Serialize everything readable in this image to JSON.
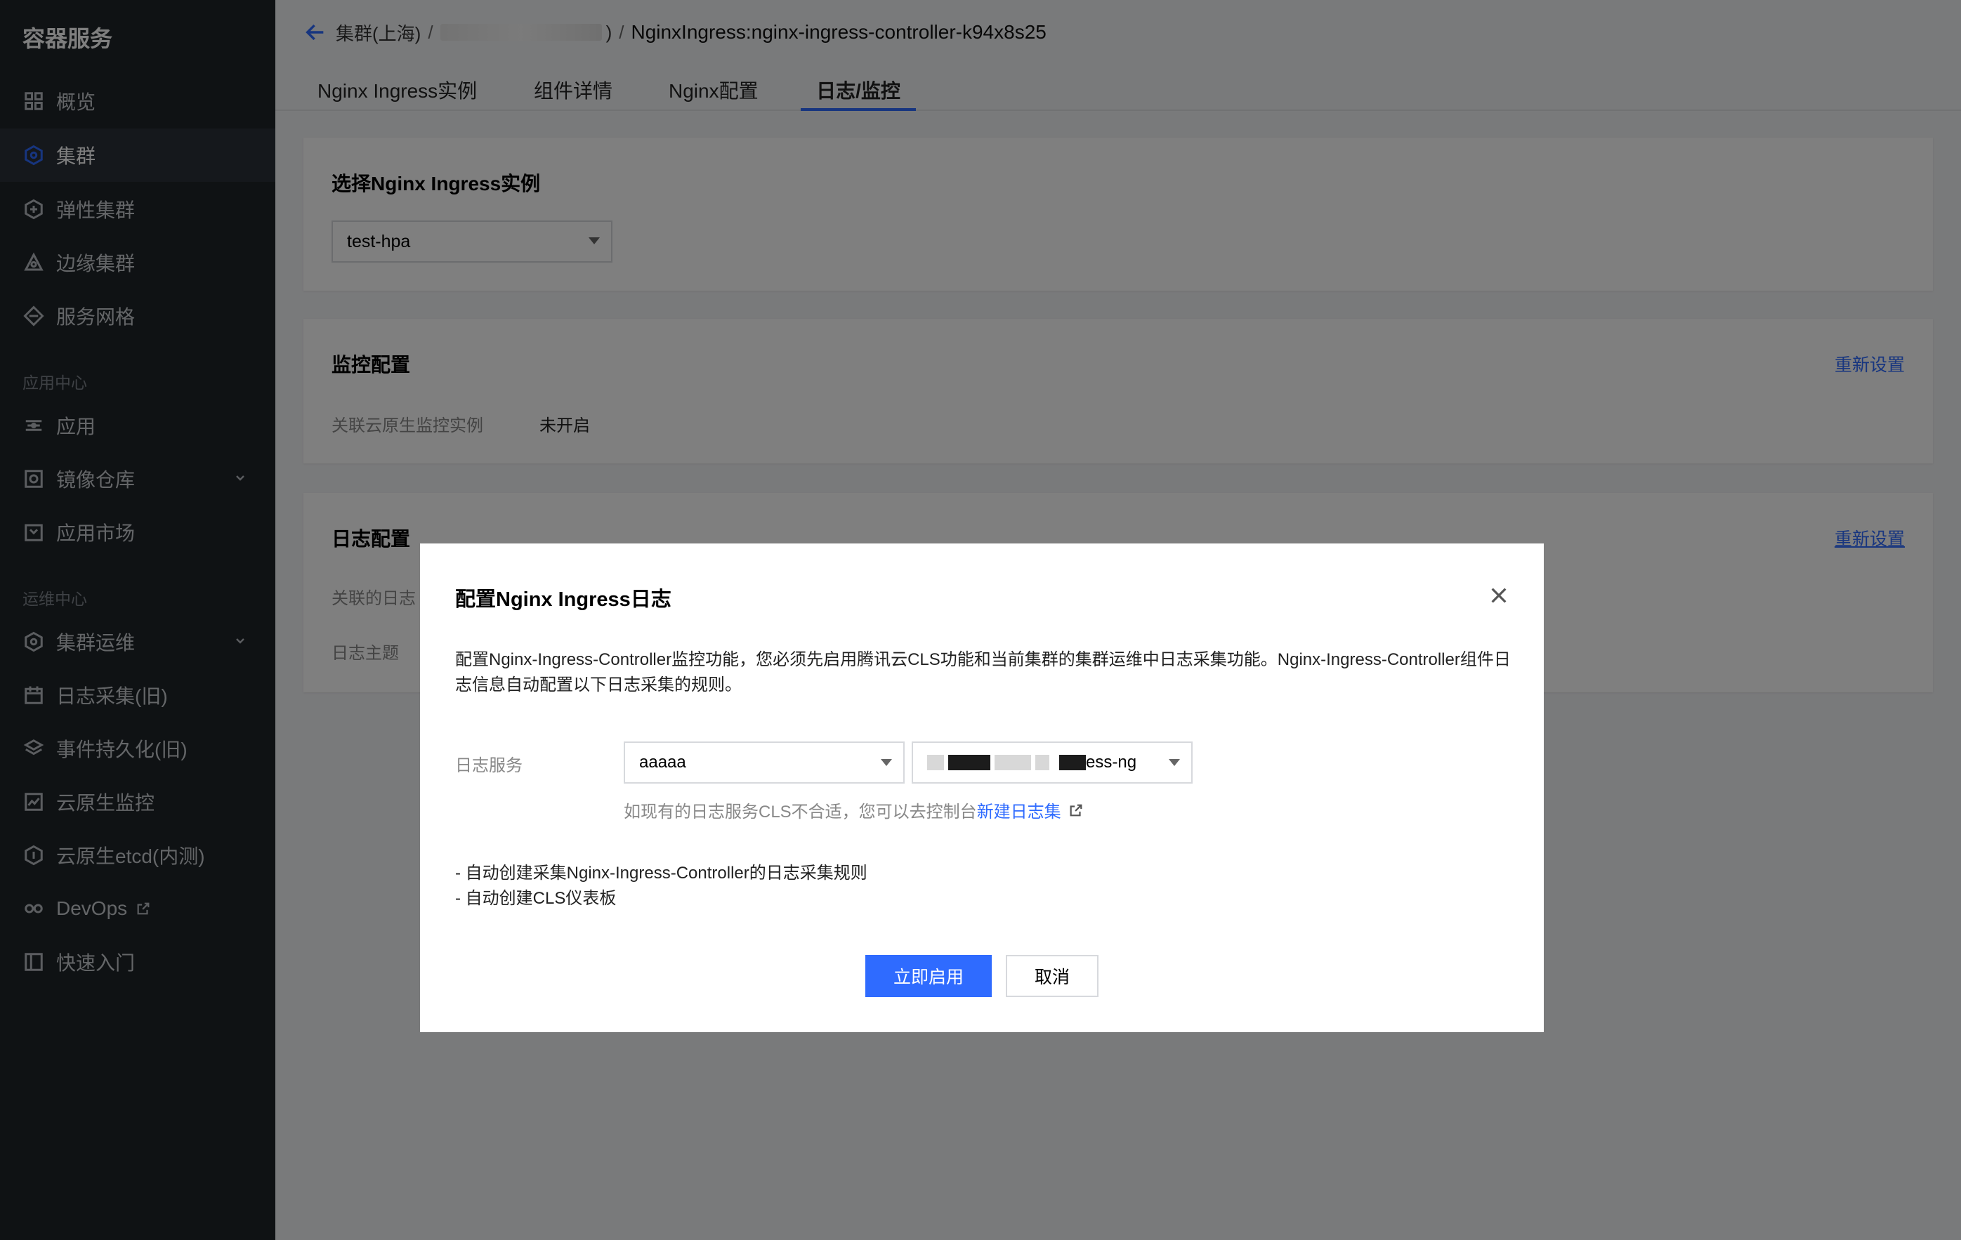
{
  "sidebar": {
    "brand": "容器服务",
    "items": [
      {
        "label": "概览",
        "icon": "dashboard-icon"
      },
      {
        "label": "集群",
        "icon": "cluster-icon",
        "active": true
      },
      {
        "label": "弹性集群",
        "icon": "elastic-cluster-icon"
      },
      {
        "label": "边缘集群",
        "icon": "edge-cluster-icon"
      },
      {
        "label": "服务网格",
        "icon": "service-mesh-icon"
      }
    ],
    "section_app": "应用中心",
    "app_items": [
      {
        "label": "应用",
        "icon": "application-icon"
      },
      {
        "label": "镜像仓库",
        "icon": "image-registry-icon"
      },
      {
        "label": "应用市场",
        "icon": "app-market-icon"
      }
    ],
    "section_ops": "运维中心",
    "ops_items": [
      {
        "label": "集群运维",
        "icon": "cluster-ops-icon"
      },
      {
        "label": "日志采集(旧)",
        "icon": "log-collect-icon"
      },
      {
        "label": "事件持久化(旧)",
        "icon": "event-persist-icon"
      },
      {
        "label": "云原生监控",
        "icon": "monitor-icon"
      },
      {
        "label": "云原生etcd(内测)",
        "icon": "etcd-icon"
      },
      {
        "label": "DevOps",
        "icon": "devops-icon"
      },
      {
        "label": "快速入门",
        "icon": "quickstart-icon"
      }
    ]
  },
  "header": {
    "breadcrumb_root": "集群(上海)",
    "breadcrumb_sep": "/",
    "breadcrumb_close": ")",
    "breadcrumb_current": "NginxIngress:nginx-ingress-controller-k94x8s25"
  },
  "tabs": [
    {
      "label": "Nginx Ingress实例"
    },
    {
      "label": "组件详情"
    },
    {
      "label": "Nginx配置"
    },
    {
      "label": "日志/监控",
      "active": true
    }
  ],
  "instance_card": {
    "title": "选择Nginx Ingress实例",
    "selected": "test-hpa"
  },
  "monitor_card": {
    "title": "监控配置",
    "reset": "重新设置",
    "field_label": "关联云原生监控实例",
    "field_value": "未开启"
  },
  "log_card": {
    "title": "日志配置",
    "reset": "重新设置",
    "field1_label": "关联的日志",
    "field2_label": "日志主题"
  },
  "dialog": {
    "title": "配置Nginx Ingress日志",
    "description": "配置Nginx-Ingress-Controller监控功能，您必须先启用腾讯云CLS功能和当前集群的集群运维中日志采集功能。Nginx-Ingress-Controller组件日志信息自动配置以下日志采集的规则。",
    "form_label": "日志服务",
    "select1_value": "aaaaa",
    "select2_suffix": "ess-ng",
    "hint_text": "如现有的日志服务CLS不合适，您可以去控制台",
    "hint_link": "新建日志集",
    "bullet1": "- 自动创建采集Nginx-Ingress-Controller的日志采集规则",
    "bullet2": "- 自动创建CLS仪表板",
    "confirm_label": "立即启用",
    "cancel_label": "取消"
  },
  "colors": {
    "accent": "#2f6bff",
    "sidebar_bg": "#1f2428"
  }
}
